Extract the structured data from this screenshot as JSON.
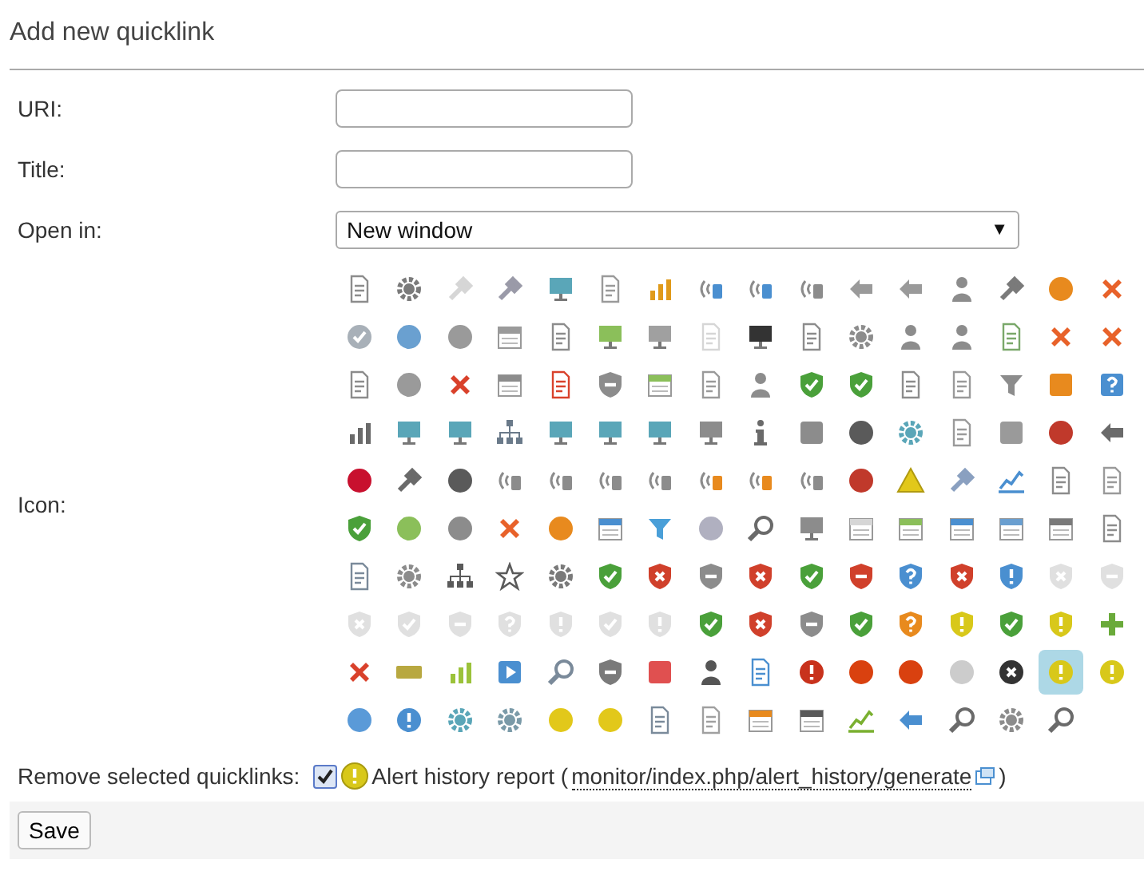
{
  "title": "Add new quicklink",
  "fields": [
    {
      "label": "URI:",
      "kind": "text"
    },
    {
      "label": "Title:",
      "kind": "text"
    },
    {
      "label": "Open in:",
      "kind": "select",
      "value": "New window",
      "caret": "▼"
    }
  ],
  "icon_label": "Icon:",
  "icons": [
    [
      {
        "kind": "doc",
        "color": "#8c8c8c",
        "selected": false
      },
      {
        "kind": "gear",
        "color": "#7a7a7a",
        "selected": false
      },
      {
        "kind": "wrench",
        "color": "#d6d6d6",
        "selected": false
      },
      {
        "kind": "wrench",
        "color": "#9a9aa8",
        "selected": false
      },
      {
        "kind": "monitor",
        "color": "#5aa6b8",
        "selected": false
      },
      {
        "kind": "doc",
        "color": "#9a9a9a",
        "selected": false
      },
      {
        "kind": "bars",
        "color": "#e09a1a",
        "selected": false
      },
      {
        "kind": "signal",
        "color": "#4a8fd0",
        "selected": false
      },
      {
        "kind": "signal",
        "color": "#4a8fd0",
        "selected": false
      },
      {
        "kind": "signal",
        "color": "#8c8c8c",
        "selected": false
      },
      {
        "kind": "arrow",
        "color": "#9a9a9a",
        "selected": false
      },
      {
        "kind": "arrow",
        "color": "#9a9a9a",
        "selected": false
      },
      {
        "kind": "person",
        "color": "#8c8c8c",
        "selected": false
      },
      {
        "kind": "wrench",
        "color": "#7a7a7a",
        "selected": false
      },
      {
        "kind": "circle",
        "color": "#e88a1e",
        "selected": false
      },
      {
        "kind": "cross",
        "color": "#e8622a",
        "selected": false
      }
    ],
    [
      {
        "kind": "circle-check",
        "color": "#a8b0b8",
        "selected": false
      },
      {
        "kind": "circle",
        "color": "#6aa0d0",
        "selected": false
      },
      {
        "kind": "circle",
        "color": "#9a9a9a",
        "selected": false
      },
      {
        "kind": "calendar",
        "color": "#9a9a9a",
        "selected": false
      },
      {
        "kind": "doc",
        "color": "#8c8c8c",
        "selected": false
      },
      {
        "kind": "monitor",
        "color": "#8bbf5a",
        "selected": false
      },
      {
        "kind": "monitor",
        "color": "#a0a0a0",
        "selected": false
      },
      {
        "kind": "doc",
        "color": "#d6d6d6",
        "selected": false
      },
      {
        "kind": "monitor",
        "color": "#333333",
        "selected": false
      },
      {
        "kind": "doc",
        "color": "#8c8c8c",
        "selected": false
      },
      {
        "kind": "gear",
        "color": "#8c8c8c",
        "selected": false
      },
      {
        "kind": "person",
        "color": "#8c8c8c",
        "selected": false
      },
      {
        "kind": "person",
        "color": "#8c8c8c",
        "selected": false
      },
      {
        "kind": "doc",
        "color": "#7aa86a",
        "selected": false
      },
      {
        "kind": "cross",
        "color": "#e8622a",
        "selected": false
      },
      {
        "kind": "cross",
        "color": "#e8622a",
        "selected": false
      }
    ],
    [
      {
        "kind": "doc",
        "color": "#8c8c8c",
        "selected": false
      },
      {
        "kind": "circle",
        "color": "#9a9a9a",
        "selected": false
      },
      {
        "kind": "cross",
        "color": "#d9412b",
        "selected": false
      },
      {
        "kind": "calendar",
        "color": "#8c8c8c",
        "selected": false
      },
      {
        "kind": "doc",
        "color": "#d9412b",
        "selected": false
      },
      {
        "kind": "shield-minus",
        "color": "#8c8c8c",
        "selected": false
      },
      {
        "kind": "calendar",
        "color": "#8bbf5a",
        "selected": false
      },
      {
        "kind": "doc",
        "color": "#9a9a9a",
        "selected": false
      },
      {
        "kind": "person",
        "color": "#8c8c8c",
        "selected": false
      },
      {
        "kind": "shield-check",
        "color": "#4aa03a",
        "selected": false
      },
      {
        "kind": "shield-check",
        "color": "#4aa03a",
        "selected": false
      },
      {
        "kind": "doc",
        "color": "#8c8c8c",
        "selected": false
      },
      {
        "kind": "doc",
        "color": "#9a9a9a",
        "selected": false
      },
      {
        "kind": "funnel",
        "color": "#8c8c8c",
        "selected": false
      },
      {
        "kind": "square",
        "color": "#e88a1e",
        "selected": false
      },
      {
        "kind": "square-q",
        "color": "#4a8fd0",
        "selected": false
      }
    ],
    [
      {
        "kind": "bars",
        "color": "#6a6a6a",
        "selected": false
      },
      {
        "kind": "monitor",
        "color": "#5aa6b8",
        "selected": false
      },
      {
        "kind": "monitor",
        "color": "#5aa6b8",
        "selected": false
      },
      {
        "kind": "tree",
        "color": "#6a7a8a",
        "selected": false
      },
      {
        "kind": "monitor",
        "color": "#5aa6b8",
        "selected": false
      },
      {
        "kind": "monitor",
        "color": "#5aa6b8",
        "selected": false
      },
      {
        "kind": "monitor",
        "color": "#5aa6b8",
        "selected": false
      },
      {
        "kind": "monitor",
        "color": "#8c8c8c",
        "selected": false
      },
      {
        "kind": "info",
        "color": "#6a6a6a",
        "selected": false
      },
      {
        "kind": "square",
        "color": "#8c8c8c",
        "selected": false
      },
      {
        "kind": "circle",
        "color": "#5a5a5a",
        "selected": false
      },
      {
        "kind": "gear",
        "color": "#5aa6b8",
        "selected": false
      },
      {
        "kind": "doc",
        "color": "#9a9a9a",
        "selected": false
      },
      {
        "kind": "square",
        "color": "#9a9a9a",
        "selected": false
      },
      {
        "kind": "circle",
        "color": "#c0392b",
        "selected": false
      },
      {
        "kind": "arrow",
        "color": "#6a6a6a",
        "selected": false
      }
    ],
    [
      {
        "kind": "circle",
        "color": "#c8102e",
        "selected": false
      },
      {
        "kind": "wrench",
        "color": "#6a6a6a",
        "selected": false
      },
      {
        "kind": "circle",
        "color": "#5a5a5a",
        "selected": false
      },
      {
        "kind": "signal",
        "color": "#8c8c8c",
        "selected": false
      },
      {
        "kind": "signal",
        "color": "#8c8c8c",
        "selected": false
      },
      {
        "kind": "signal",
        "color": "#8c8c8c",
        "selected": false
      },
      {
        "kind": "signal",
        "color": "#8c8c8c",
        "selected": false
      },
      {
        "kind": "signal",
        "color": "#e88a1e",
        "selected": false
      },
      {
        "kind": "signal",
        "color": "#e88a1e",
        "selected": false
      },
      {
        "kind": "signal",
        "color": "#8c8c8c",
        "selected": false
      },
      {
        "kind": "circle",
        "color": "#c0392b",
        "selected": false
      },
      {
        "kind": "warning",
        "color": "#e2c81a",
        "selected": false
      },
      {
        "kind": "wrench",
        "color": "#8aa0c0",
        "selected": false
      },
      {
        "kind": "chart",
        "color": "#4a8fd0",
        "selected": false
      },
      {
        "kind": "doc",
        "color": "#8c8c8c",
        "selected": false
      },
      {
        "kind": "doc",
        "color": "#9a9a9a",
        "selected": false
      }
    ],
    [
      {
        "kind": "shield-check",
        "color": "#4aa03a",
        "selected": false
      },
      {
        "kind": "circle",
        "color": "#8bbf5a",
        "selected": false
      },
      {
        "kind": "circle",
        "color": "#8c8c8c",
        "selected": false
      },
      {
        "kind": "cross",
        "color": "#e8622a",
        "selected": false
      },
      {
        "kind": "circle",
        "color": "#e88a1e",
        "selected": false
      },
      {
        "kind": "calendar",
        "color": "#4a8fd0",
        "selected": false
      },
      {
        "kind": "funnel",
        "color": "#4a9fd8",
        "selected": false
      },
      {
        "kind": "circle",
        "color": "#b0b0c0",
        "selected": false
      },
      {
        "kind": "search",
        "color": "#6a6a6a",
        "selected": false
      },
      {
        "kind": "monitor",
        "color": "#8c8c8c",
        "selected": false
      },
      {
        "kind": "calendar",
        "color": "#d6d6d6",
        "selected": false
      },
      {
        "kind": "calendar",
        "color": "#8bbf5a",
        "selected": false
      },
      {
        "kind": "calendar",
        "color": "#4a8fd0",
        "selected": false
      },
      {
        "kind": "calendar",
        "color": "#6a9fd0",
        "selected": false
      },
      {
        "kind": "calendar",
        "color": "#7a7a7a",
        "selected": false
      },
      {
        "kind": "doc",
        "color": "#8c8c8c",
        "selected": false
      }
    ],
    [
      {
        "kind": "doc",
        "color": "#7a8a9a",
        "selected": false
      },
      {
        "kind": "gear",
        "color": "#8c8c8c",
        "selected": false
      },
      {
        "kind": "tree",
        "color": "#5a5a5a",
        "selected": false
      },
      {
        "kind": "star",
        "color": "#5a5a5a",
        "selected": false
      },
      {
        "kind": "gear",
        "color": "#7a7a7a",
        "selected": false
      },
      {
        "kind": "shield-check",
        "color": "#4aa03a",
        "selected": false
      },
      {
        "kind": "shield-x",
        "color": "#d0402b",
        "selected": false
      },
      {
        "kind": "shield-minus",
        "color": "#8c8c8c",
        "selected": false
      },
      {
        "kind": "shield-x",
        "color": "#d0402b",
        "selected": false
      },
      {
        "kind": "shield-check",
        "color": "#4aa03a",
        "selected": false
      },
      {
        "kind": "shield-minus",
        "color": "#d0402b",
        "selected": false
      },
      {
        "kind": "shield-q",
        "color": "#4a8fd0",
        "selected": false
      },
      {
        "kind": "shield-x",
        "color": "#d0402b",
        "selected": false
      },
      {
        "kind": "shield-excl",
        "color": "#4a8fd0",
        "selected": false
      },
      {
        "kind": "shield-x",
        "color": "#e0e0e0",
        "selected": false
      },
      {
        "kind": "shield-minus",
        "color": "#e0e0e0",
        "selected": false
      }
    ],
    [
      {
        "kind": "shield-x",
        "color": "#e0e0e0",
        "selected": false
      },
      {
        "kind": "shield-check",
        "color": "#e0e0e0",
        "selected": false
      },
      {
        "kind": "shield-minus",
        "color": "#e0e0e0",
        "selected": false
      },
      {
        "kind": "shield-q",
        "color": "#e0e0e0",
        "selected": false
      },
      {
        "kind": "shield-excl",
        "color": "#e0e0e0",
        "selected": false
      },
      {
        "kind": "shield-check",
        "color": "#e0e0e0",
        "selected": false
      },
      {
        "kind": "shield-excl",
        "color": "#e0e0e0",
        "selected": false
      },
      {
        "kind": "shield-check",
        "color": "#4aa03a",
        "selected": false
      },
      {
        "kind": "shield-x",
        "color": "#d0402b",
        "selected": false
      },
      {
        "kind": "shield-minus",
        "color": "#8c8c8c",
        "selected": false
      },
      {
        "kind": "shield-check",
        "color": "#4aa03a",
        "selected": false
      },
      {
        "kind": "shield-q",
        "color": "#e88a1e",
        "selected": false
      },
      {
        "kind": "shield-excl",
        "color": "#d8c81a",
        "selected": false
      },
      {
        "kind": "shield-check",
        "color": "#4aa03a",
        "selected": false
      },
      {
        "kind": "shield-excl",
        "color": "#d8c81a",
        "selected": false
      },
      {
        "kind": "plus",
        "color": "#6aaa3a",
        "selected": false
      }
    ],
    [
      {
        "kind": "cross",
        "color": "#d9412b",
        "selected": false
      },
      {
        "kind": "minus",
        "color": "#b8a840",
        "selected": false
      },
      {
        "kind": "bars",
        "color": "#9bc23a",
        "selected": false
      },
      {
        "kind": "square-play",
        "color": "#4a8fd0",
        "selected": false
      },
      {
        "kind": "search",
        "color": "#7a8a9a",
        "selected": false
      },
      {
        "kind": "shield-minus",
        "color": "#7a7a7a",
        "selected": false
      },
      {
        "kind": "square",
        "color": "#e05050",
        "selected": false
      },
      {
        "kind": "person",
        "color": "#555555",
        "selected": false
      },
      {
        "kind": "doc",
        "color": "#4a8fd0",
        "selected": false
      },
      {
        "kind": "circle-excl",
        "color": "#c8321c",
        "selected": false
      },
      {
        "kind": "circle",
        "color": "#d9410f",
        "selected": false
      },
      {
        "kind": "circle",
        "color": "#d9410f",
        "selected": false
      },
      {
        "kind": "circle",
        "color": "#cccccc",
        "selected": false
      },
      {
        "kind": "circle-x",
        "color": "#333333",
        "selected": false
      },
      {
        "kind": "circle-excl",
        "color": "#d8c81a",
        "selected": true
      },
      {
        "kind": "circle-excl",
        "color": "#d8c81a",
        "selected": false
      }
    ],
    [
      {
        "kind": "circle",
        "color": "#5a9ad8",
        "selected": false
      },
      {
        "kind": "circle-excl",
        "color": "#4a8fd0",
        "selected": false
      },
      {
        "kind": "gear",
        "color": "#5aa6b8",
        "selected": false
      },
      {
        "kind": "gear",
        "color": "#7a9aa8",
        "selected": false
      },
      {
        "kind": "circle",
        "color": "#e2c81a",
        "selected": false
      },
      {
        "kind": "circle",
        "color": "#e2c81a",
        "selected": false
      },
      {
        "kind": "doc",
        "color": "#7a8a9a",
        "selected": false
      },
      {
        "kind": "doc",
        "color": "#a0a0a0",
        "selected": false
      },
      {
        "kind": "calendar",
        "color": "#e88a1e",
        "selected": false
      },
      {
        "kind": "calendar",
        "color": "#5a5a5a",
        "selected": false
      },
      {
        "kind": "chart",
        "color": "#7ab030",
        "selected": false
      },
      {
        "kind": "arrow",
        "color": "#4a8fd0",
        "selected": false
      },
      {
        "kind": "search",
        "color": "#6a6a6a",
        "selected": false
      },
      {
        "kind": "gear",
        "color": "#8c8c8c",
        "selected": false
      },
      {
        "kind": "search",
        "color": "#6a6a6a",
        "selected": false
      }
    ]
  ],
  "remove": {
    "label": "Remove selected quicklinks:",
    "items": [
      {
        "checked": true,
        "color": "#d8c81a",
        "text": "Alert history report (",
        "link": "monitor/index.php/alert_history/generate",
        "close": ")"
      }
    ]
  },
  "save": "Save"
}
